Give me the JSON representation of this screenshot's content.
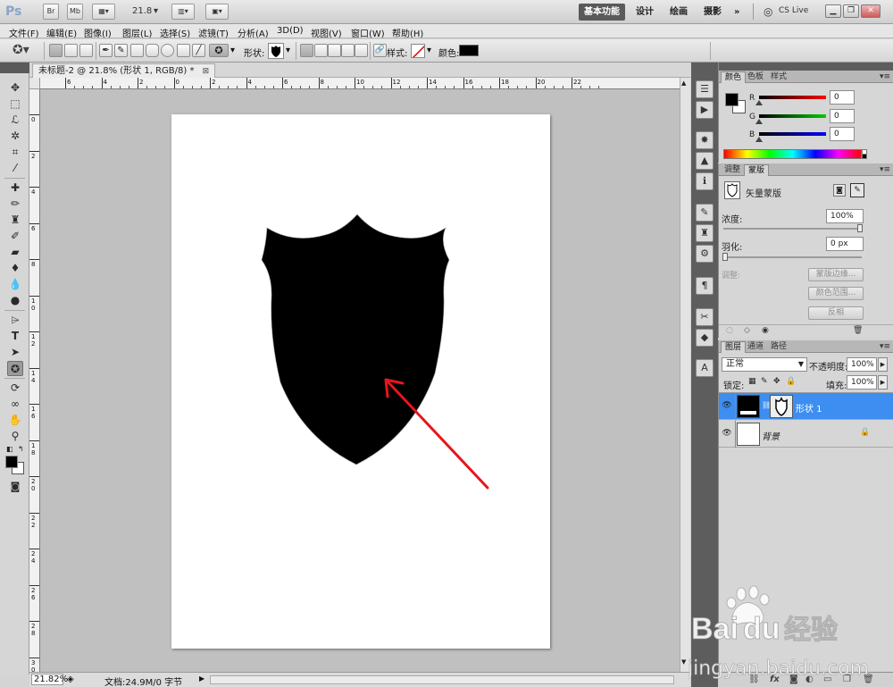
{
  "app": {
    "logo": "Ps",
    "bridge_label": "Br",
    "minibridge_label": "Mb",
    "zoom_value": "21.8",
    "workspaces": [
      "基本功能",
      "设计",
      "绘画",
      "摄影"
    ],
    "more": "»",
    "cs_live": "CS Live"
  },
  "menu": [
    "文件(F)",
    "编辑(E)",
    "图像(I)",
    "图层(L)",
    "选择(S)",
    "滤镜(T)",
    "分析(A)",
    "3D(D)",
    "视图(V)",
    "窗口(W)",
    "帮助(H)"
  ],
  "options": {
    "shape_label": "形状:",
    "style_label": "样式:",
    "color_label": "颜色:",
    "color": "#000000"
  },
  "document": {
    "tab_title": "未标题-2 @ 21.8% (形状 1, RGB/8) *",
    "h_ruler": [
      "6",
      "4",
      "2",
      "0",
      "2",
      "4",
      "6",
      "8",
      "10",
      "12",
      "14",
      "16",
      "18",
      "20",
      "22"
    ],
    "v_ruler": [
      "0",
      "2",
      "4",
      "6",
      "8",
      "1\n0",
      "1\n2",
      "1\n4",
      "1\n6",
      "1\n8",
      "2\n0",
      "2\n2",
      "2\n4",
      "2\n6",
      "2\n8",
      "3\n0"
    ],
    "shape_fill": "#000000",
    "arrow_color": "#e8151b"
  },
  "status": {
    "zoom": "21.82%",
    "doc_info": "文档:24.9M/0 字节"
  },
  "color_panel": {
    "tabs": [
      "颜色",
      "色板",
      "样式"
    ],
    "channels": [
      {
        "label": "R",
        "value": "0"
      },
      {
        "label": "G",
        "value": "0"
      },
      {
        "label": "B",
        "value": "0"
      }
    ],
    "foreground": "#000000",
    "background": "#ffffff"
  },
  "masks_panel": {
    "tabs": [
      "调整",
      "蒙版"
    ],
    "mask_type": "矢量蒙版",
    "density_label": "浓度:",
    "density_value": "100%",
    "feather_label": "羽化:",
    "feather_value": "0 px",
    "refine_label": "调整:",
    "mask_edge_btn": "蒙版边缘...",
    "color_range_btn": "颜色范围...",
    "invert_btn": "反相"
  },
  "layers_panel": {
    "tabs": [
      "图层",
      "通道",
      "路径"
    ],
    "blend_mode": "正常",
    "opacity_label": "不透明度:",
    "opacity_value": "100%",
    "lock_label": "锁定:",
    "fill_label": "填充:",
    "fill_value": "100%",
    "layers": [
      {
        "name": "形状 1",
        "selected": true
      },
      {
        "name": "背景",
        "selected": false
      }
    ],
    "bottom_icons": [
      "link-icon",
      "fx-icon",
      "mask-icon",
      "adjustment-icon",
      "group-icon",
      "new-layer-icon",
      "trash-icon"
    ]
  },
  "watermark": {
    "brand": "Bai",
    "brand_suffix": "经验",
    "url": "jingyan.baidu.com"
  }
}
